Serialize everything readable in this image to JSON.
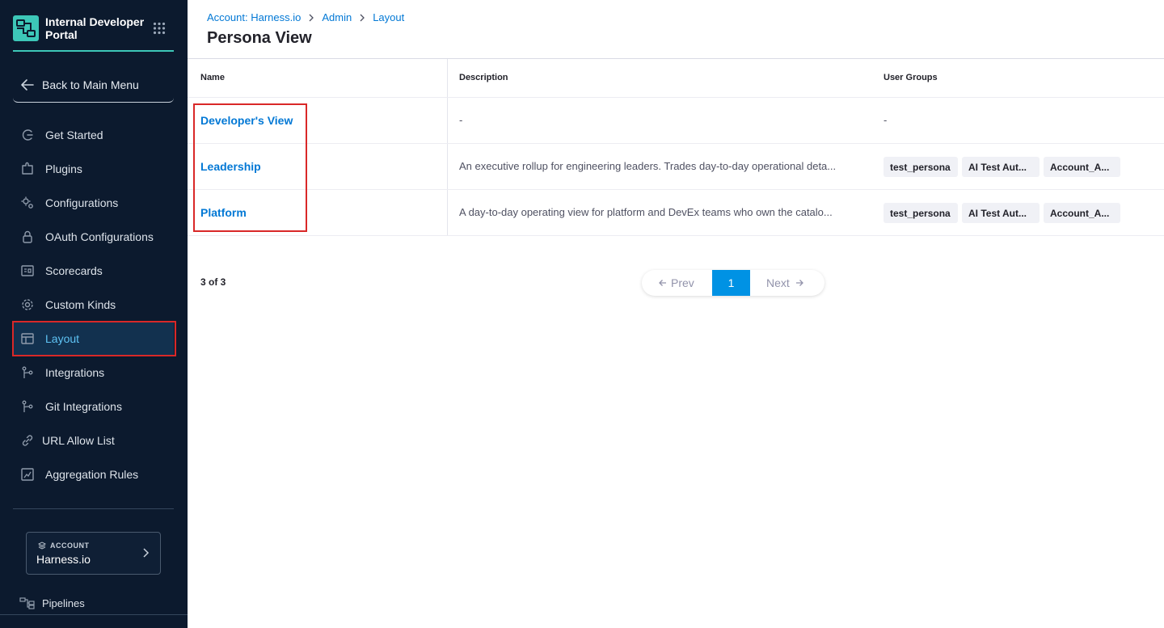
{
  "brand": {
    "title": "Internal Developer Portal",
    "accent": "#3dc7b8"
  },
  "sidebar": {
    "back_label": "Back to Main Menu",
    "items": [
      {
        "label": "Get Started",
        "icon": "get-started-icon"
      },
      {
        "label": "Plugins",
        "icon": "plugins-icon"
      },
      {
        "label": "Configurations",
        "icon": "configurations-icon"
      },
      {
        "label": "OAuth Configurations",
        "icon": "lock-icon"
      },
      {
        "label": "Scorecards",
        "icon": "scorecard-icon"
      },
      {
        "label": "Custom Kinds",
        "icon": "gear-icon"
      },
      {
        "label": "Layout",
        "icon": "layout-icon",
        "active": true
      },
      {
        "label": "Integrations",
        "icon": "integrations-icon"
      },
      {
        "label": "Git Integrations",
        "icon": "git-icon"
      },
      {
        "label": "URL Allow List",
        "icon": "link-icon"
      },
      {
        "label": "Aggregation Rules",
        "icon": "aggregation-icon"
      }
    ],
    "account": {
      "caption": "ACCOUNT",
      "name": "Harness.io"
    },
    "pipelines_label": "Pipelines"
  },
  "breadcrumb": [
    "Account: Harness.io",
    "Admin",
    "Layout"
  ],
  "page_title": "Persona View",
  "table": {
    "headers": [
      "Name",
      "Description",
      "User Groups"
    ],
    "rows": [
      {
        "name": "Developer's View",
        "description": "-",
        "groups": []
      },
      {
        "name": "Leadership",
        "description": "An executive rollup for engineering leaders. Trades day-to-day operational deta...",
        "groups": [
          "test_persona",
          "AI Test Aut...",
          "Account_A..."
        ]
      },
      {
        "name": "Platform",
        "description": "A day-to-day operating view for platform and DevEx teams who own the catalo...",
        "groups": [
          "test_persona",
          "AI Test Aut...",
          "Account_A..."
        ]
      }
    ],
    "empty_groups": "-"
  },
  "pagination": {
    "count": "3 of 3",
    "prev": "Prev",
    "next": "Next",
    "current": "1"
  },
  "colors": {
    "sidebar_bg": "#0c1a2e",
    "link": "#0278d5",
    "page_active": "#0092e4",
    "highlight": "#d92828"
  }
}
